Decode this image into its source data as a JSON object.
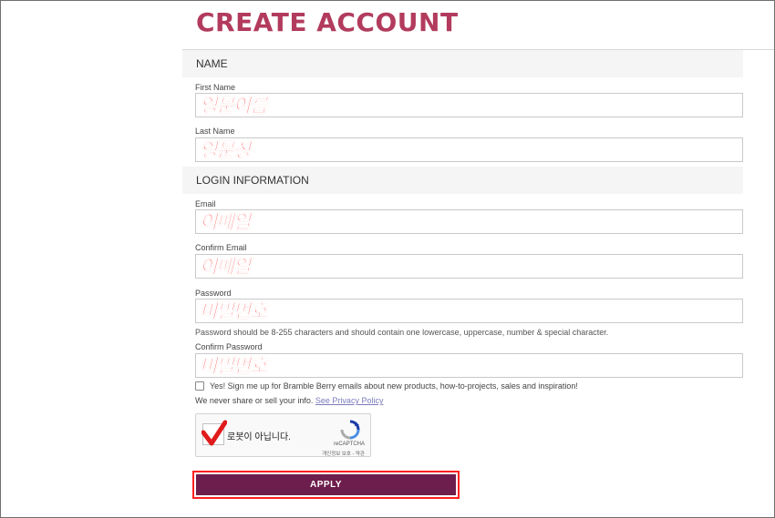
{
  "title": "CREATE ACCOUNT",
  "sections": {
    "name": "NAME",
    "login": "LOGIN INFORMATION"
  },
  "fields": {
    "first_name": {
      "label": "First Name",
      "value": "영문이름"
    },
    "last_name": {
      "label": "Last Name",
      "value": "영문성"
    },
    "email": {
      "label": "Email",
      "value": "이메일"
    },
    "confirm_email": {
      "label": "Confirm Email",
      "value": "이메일"
    },
    "password": {
      "label": "Password",
      "value": "비밀번호"
    },
    "confirm_password": {
      "label": "Confirm Password",
      "value": "비밀번호"
    }
  },
  "password_hint": "Password should be 8-255 characters and should contain one lowercase, uppercase, number & special character.",
  "newsletter": {
    "label": "Yes! Sign me up for Bramble Berry emails about new products, how-to-projects, sales and inspiration!",
    "checked": false
  },
  "privacy": {
    "text": "We never share or sell your info.",
    "link": "See Privacy Policy"
  },
  "captcha": {
    "label": "로봇이 아닙니다.",
    "brand": "reCAPTCHA",
    "terms": "개인정보 보호 - 약관"
  },
  "apply_label": "APPLY",
  "colors": {
    "title": "#b23b5d",
    "button": "#6d1e4c",
    "annotation": "#ff1a1a"
  }
}
